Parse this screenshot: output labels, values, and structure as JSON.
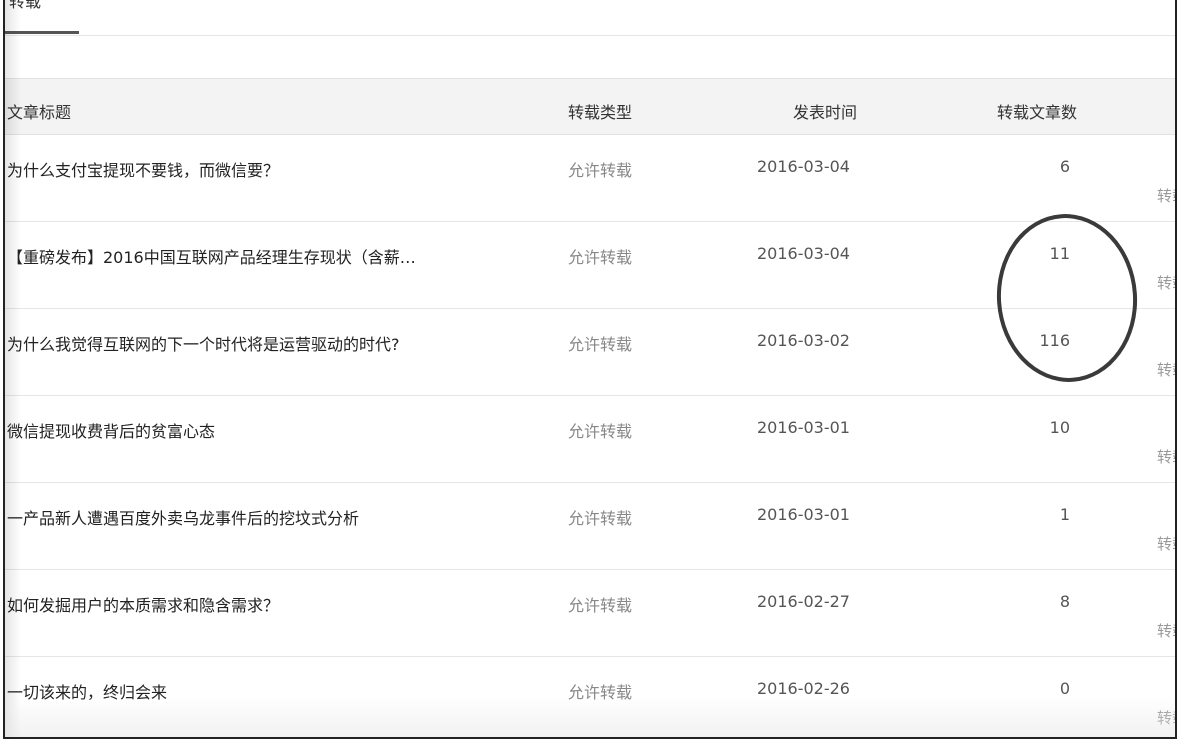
{
  "tabs": {
    "active_label": "转载"
  },
  "table": {
    "headers": {
      "title": "文章标题",
      "type": "转载类型",
      "date": "发表时间",
      "count": "转载文章数"
    },
    "rows": [
      {
        "title": "为什么支付宝提现不要钱，而微信要？",
        "type": "允许转载",
        "date": "2016-03-04",
        "count": "6",
        "action": "转载"
      },
      {
        "title": "【重磅发布】2016中国互联网产品经理生存现状（含薪…",
        "type": "允许转载",
        "date": "2016-03-04",
        "count": "11",
        "action": "转载"
      },
      {
        "title": "为什么我觉得互联网的下一个时代将是运营驱动的时代?",
        "type": "允许转载",
        "date": "2016-03-02",
        "count": "116",
        "action": "转载"
      },
      {
        "title": "微信提现收费背后的贫富心态",
        "type": "允许转载",
        "date": "2016-03-01",
        "count": "10",
        "action": "转载"
      },
      {
        "title": "一产品新人遭遇百度外卖乌龙事件后的挖坟式分析",
        "type": "允许转载",
        "date": "2016-03-01",
        "count": "1",
        "action": "转载"
      },
      {
        "title": "如何发掘用户的本质需求和隐含需求？",
        "type": "允许转载",
        "date": "2016-02-27",
        "count": "8",
        "action": "转载"
      },
      {
        "title": "一切该来的，终归会来",
        "type": "允许转载",
        "date": "2016-02-26",
        "count": "0",
        "action": "转载"
      }
    ]
  },
  "colors": {
    "header_bg": "#f3f3f3",
    "divider": "#e6e6e6",
    "annotation": "#3a3a3a"
  }
}
